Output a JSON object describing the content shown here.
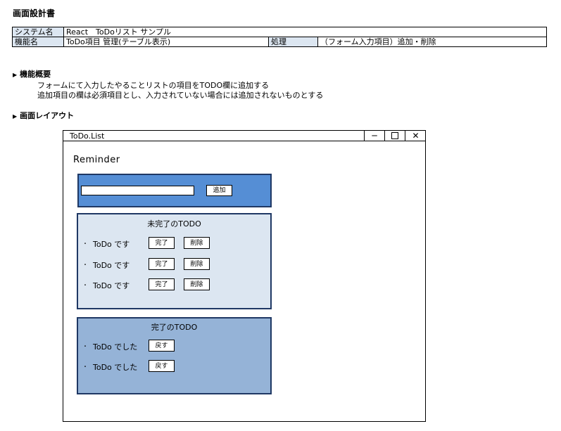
{
  "document": {
    "title": "画面設計書",
    "meta": {
      "system_label": "システム名",
      "system_value": "React　ToDoリスト サンプル",
      "function_label": "機能名",
      "function_value": "ToDo項目 管理(テーブル表示)",
      "process_label": "処理",
      "process_value": "（フォーム入力項目）追加・削除"
    },
    "overview": {
      "heading": "機能概要",
      "lines": [
        "フォームにて入力したやることリストの項目をTODO欄に追加する",
        "追加項目の欄は必須項目とし、入力されていない場合には追加されないものとする"
      ]
    },
    "layout_heading": "画面レイアウト"
  },
  "window": {
    "title": "ToDo.List",
    "controls": {
      "minimize": "─",
      "close": "✕"
    },
    "app_title": "Reminder",
    "input_area": {
      "value": "",
      "add_label": "追加"
    },
    "incomplete": {
      "title": "未完了のTODO",
      "items": [
        {
          "label": "ToDo です",
          "complete_label": "完了",
          "delete_label": "削除"
        },
        {
          "label": "ToDo です",
          "complete_label": "完了",
          "delete_label": "削除"
        },
        {
          "label": "ToDo です",
          "complete_label": "完了",
          "delete_label": "削除"
        }
      ]
    },
    "complete": {
      "title": "完了のTODO",
      "items": [
        {
          "label": "ToDo でした",
          "back_label": "戻す"
        },
        {
          "label": "ToDo でした",
          "back_label": "戻す"
        }
      ]
    }
  }
}
